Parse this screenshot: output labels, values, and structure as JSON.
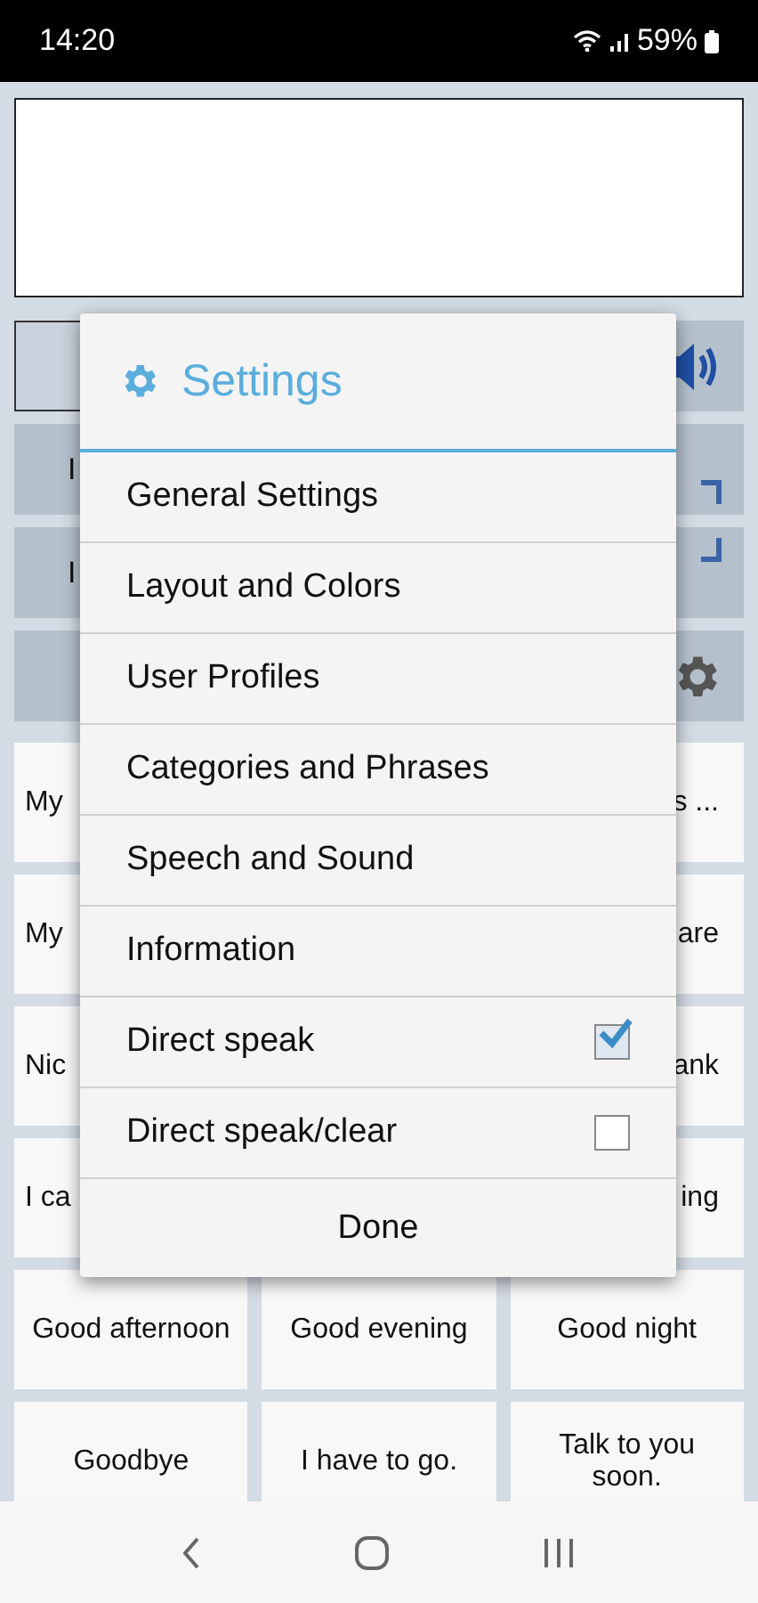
{
  "status_bar": {
    "time": "14:20",
    "battery": "59%"
  },
  "left_buttons": [
    {
      "kind": "outlined"
    },
    {
      "text": "I",
      "kind": "filled"
    },
    {
      "text": "I",
      "kind": "filled"
    },
    {
      "kind": "filled"
    }
  ],
  "phrase_rows": [
    {
      "left": "My",
      "right": "s ..."
    },
    {
      "left": "My",
      "right": "are"
    },
    {
      "left": "Nic",
      "right": "ank"
    },
    {
      "left": "I ca",
      "right": "ing"
    },
    {
      "cells": [
        "Good afternoon",
        "Good evening",
        "Good night"
      ]
    },
    {
      "cells": [
        "Goodbye",
        "I have to go.",
        "Talk to you soon."
      ]
    }
  ],
  "dialog": {
    "title": "Settings",
    "items": [
      {
        "label": "General Settings",
        "kind": "link"
      },
      {
        "label": "Layout and Colors",
        "kind": "link"
      },
      {
        "label": "User Profiles",
        "kind": "link"
      },
      {
        "label": "Categories and Phrases",
        "kind": "link"
      },
      {
        "label": "Speech and Sound",
        "kind": "link"
      },
      {
        "label": "Information",
        "kind": "link"
      },
      {
        "label": "Direct speak",
        "kind": "checkbox",
        "checked": true
      },
      {
        "label": "Direct speak/clear",
        "kind": "checkbox",
        "checked": false
      }
    ],
    "done": "Done"
  }
}
